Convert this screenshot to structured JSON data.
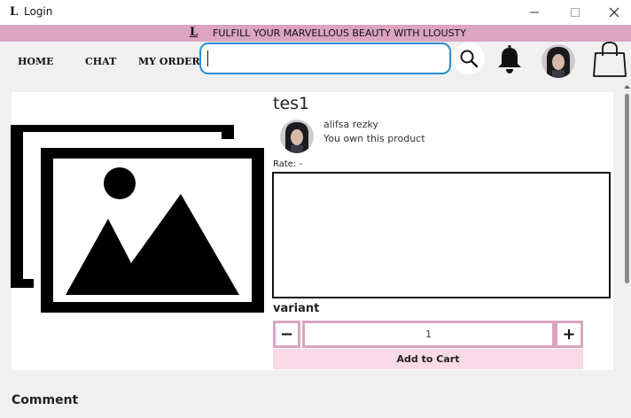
{
  "window": {
    "logo": "L",
    "title": "Login",
    "controls": {
      "minimize": "—",
      "maximize": "☐",
      "close": "✕"
    }
  },
  "banner": {
    "logo": "L",
    "text": "FULFILL YOUR MARVELLOUS BEAUTY WITH LLOUSTY",
    "color": "#dba4bf"
  },
  "navbar": {
    "links": [
      "HOME",
      "CHAT",
      "MY ORDER"
    ],
    "search": {
      "value": "",
      "placeholder": ""
    },
    "icons": [
      "search-icon",
      "bell-icon",
      "profile-avatar",
      "shopping-bag-icon"
    ],
    "accent": "#2b8fd6"
  },
  "product": {
    "name": "tes1",
    "seller": "alifsa rezky",
    "ownership_note": "You own this product",
    "rate_label": "Rate: -",
    "description": "",
    "variant_label": "variant",
    "quantity": "1",
    "decrement_label": "−",
    "increment_label": "+",
    "add_to_cart_label": "Add to Cart",
    "button_color": "#fcd9e6",
    "border_color": "#dba4bf"
  },
  "comments": {
    "heading": "Comment"
  }
}
